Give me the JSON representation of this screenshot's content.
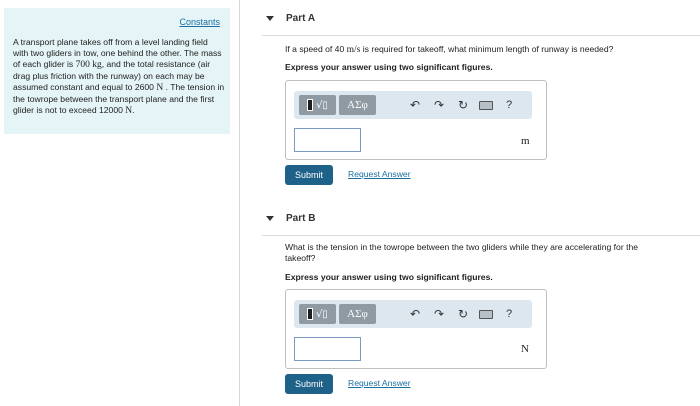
{
  "left_panel": {
    "constants_label": "Constants",
    "problem": {
      "t1": "A transport plane takes off from a level landing field with two gliders in tow, one behind the other. The mass of each glider is ",
      "m1": "700 kg",
      "t2": ", and the total resistance (air drag plus friction with the runway) on each may be assumed constant and equal to 2600 ",
      "m2": "N",
      "t3": " . The tension in the towrope between the transport plane and the first glider is not to exceed 12000 ",
      "m3": "N",
      "t4": "."
    }
  },
  "part_a": {
    "title": "Part A",
    "question": {
      "t1": "If a speed of 40 ",
      "m1": "m/s",
      "t2": " is required for takeoff, what minimum length of runway is needed?"
    },
    "instruction": "Express your answer using two significant figures.",
    "toolbar": {
      "templates_icon": "template-sqrt-icon",
      "greek_label": "ΑΣφ",
      "undo_icon": "undo-icon",
      "redo_icon": "redo-icon",
      "reset_icon": "reset-icon",
      "keyboard_icon": "keyboard-icon",
      "help_label": "?"
    },
    "input_value": "",
    "unit": "m",
    "submit_label": "Submit",
    "request_label": "Request Answer"
  },
  "part_b": {
    "title": "Part B",
    "question": "What is the tension in the towrope between the two gliders while they are accelerating for the takeoff?",
    "instruction": "Express your answer using two significant figures.",
    "toolbar": {
      "templates_icon": "template-sqrt-icon",
      "greek_label": "ΑΣφ",
      "undo_icon": "undo-icon",
      "redo_icon": "redo-icon",
      "reset_icon": "reset-icon",
      "keyboard_icon": "keyboard-icon",
      "help_label": "?"
    },
    "input_value": "",
    "unit": "N",
    "submit_label": "Submit",
    "request_label": "Request Answer"
  },
  "colors": {
    "panel_bg": "#e5f4f6",
    "link": "#1a6fa0",
    "submit_bg": "#1f6289",
    "toolbar_bg": "#dde7ef",
    "toolbar_btn": "#8f9aa3"
  }
}
